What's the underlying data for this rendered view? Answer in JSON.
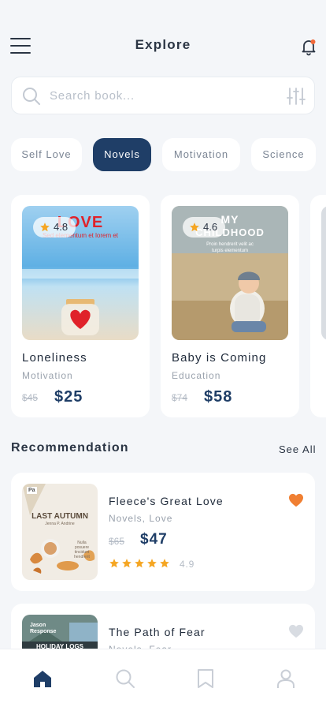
{
  "header": {
    "title": "Explore",
    "menu_icon": "menu-icon",
    "notification_icon": "bell-icon",
    "notification_dot_color": "#f26a3b"
  },
  "search": {
    "placeholder": "Search book...",
    "icon": "search-icon",
    "filter_icon": "filter-sliders-icon"
  },
  "categories": [
    {
      "label": "Self Love",
      "active": false
    },
    {
      "label": "Novels",
      "active": true
    },
    {
      "label": "Motivation",
      "active": false
    },
    {
      "label": "Science",
      "active": false
    }
  ],
  "featured": [
    {
      "title": "Loneliness",
      "category": "Motivation",
      "old_price": "$45",
      "price": "$25",
      "rating": "4.8",
      "cover_title": "LOVE",
      "cover_subtitle": "Sed elementum et lorem et"
    },
    {
      "title": "Baby is Coming",
      "category": "Education",
      "old_price": "$74",
      "price": "$58",
      "rating": "4.6",
      "cover_title_line1": "MY",
      "cover_title_line2": "CHILDHOOD",
      "cover_subtitle_line1": "Proin hendrerit velit ac",
      "cover_subtitle_line2": "turpis elementum"
    }
  ],
  "recommendation": {
    "title": "Recommendation",
    "see_all": "See All",
    "items": [
      {
        "title": "Fleece's Great Love",
        "category": "Novels, Love",
        "old_price": "$65",
        "price": "$47",
        "rating": "4.9",
        "stars": 5,
        "favorite": true,
        "cover_title": "LAST AUTUMN",
        "cover_author": "Jenna P. Andrine",
        "cover_quote_1": "Nulla",
        "cover_quote_2": "posuere",
        "cover_quote_3": "tincidunt",
        "cover_quote_4": "hendrerit",
        "cover_badge": "Pa"
      },
      {
        "title": "The Path of Fear",
        "category": "Novels, Fear",
        "favorite": false,
        "cover_author_1": "Jason",
        "cover_author_2": "Response",
        "cover_title": "HOLIDAY LOGS"
      }
    ]
  },
  "colors": {
    "primary": "#1f3e67",
    "accent": "#f07f32",
    "star": "#f5a623",
    "heart_active": "#f07f32",
    "heart_inactive": "#d8dce2"
  },
  "tabbar": [
    {
      "name": "home",
      "icon": "home-icon",
      "active": true
    },
    {
      "name": "search",
      "icon": "search-icon",
      "active": false
    },
    {
      "name": "bookmark",
      "icon": "bookmark-icon",
      "active": false
    },
    {
      "name": "profile",
      "icon": "profile-icon",
      "active": false
    }
  ]
}
